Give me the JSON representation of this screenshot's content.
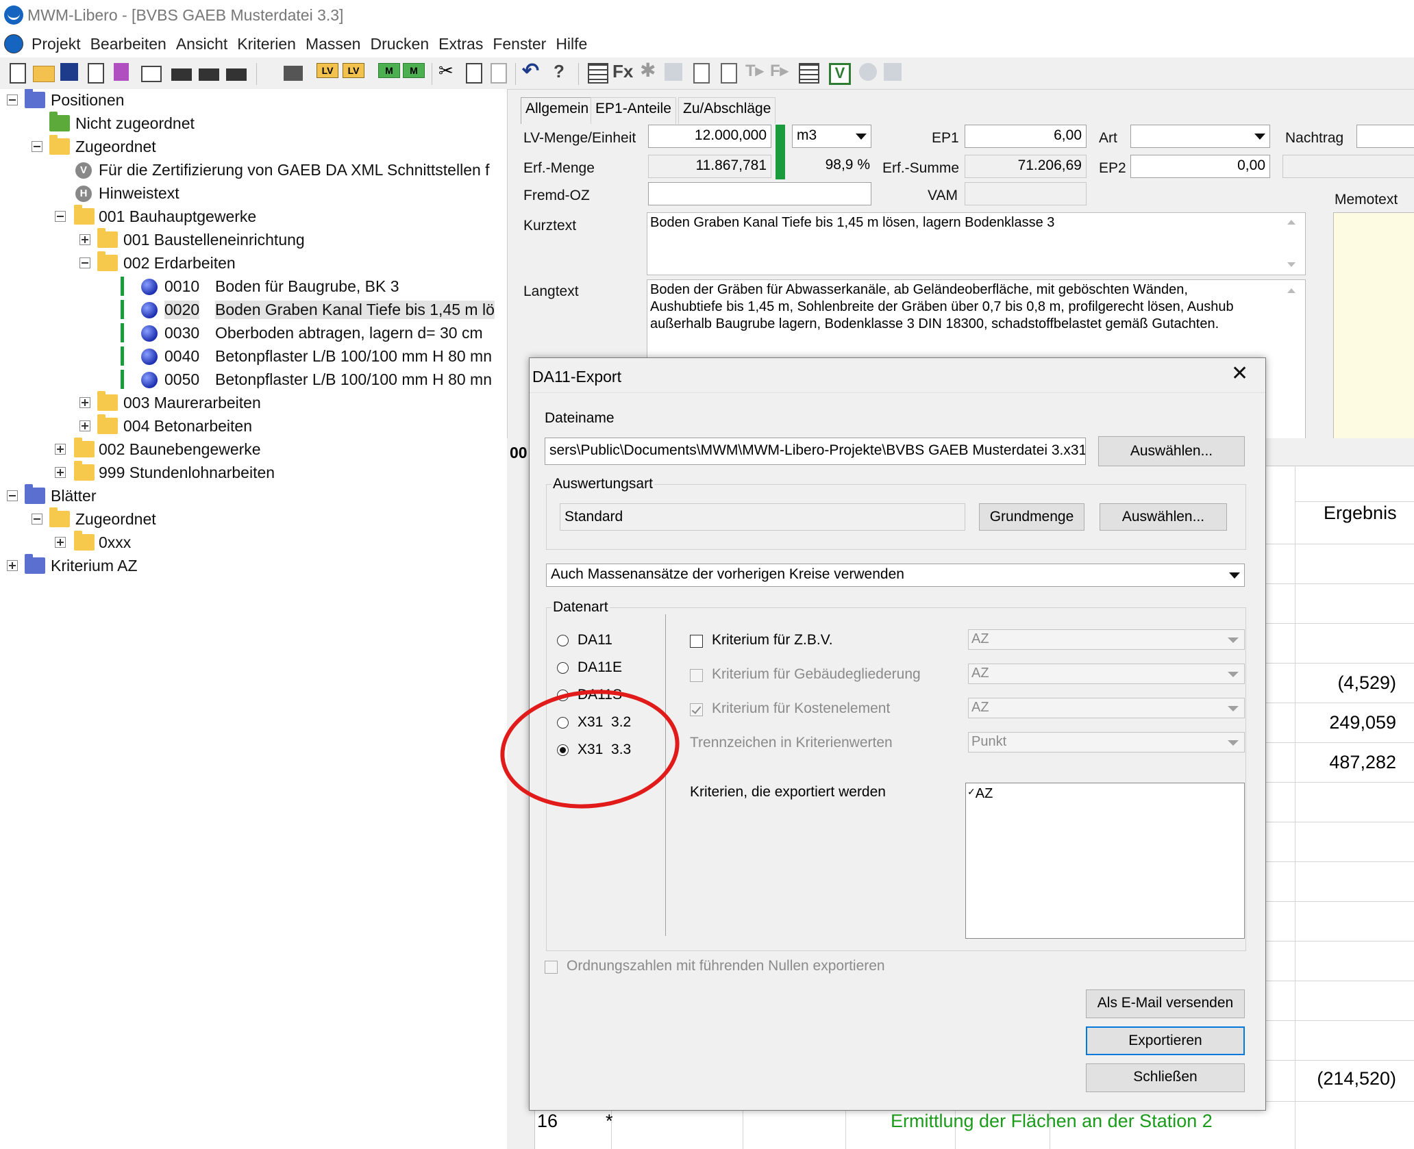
{
  "window": {
    "title": "MWM-Libero - [BVBS GAEB Musterdatei 3.3]"
  },
  "menu": [
    "Projekt",
    "Bearbeiten",
    "Ansicht",
    "Kriterien",
    "Massen",
    "Drucken",
    "Extras",
    "Fenster",
    "Hilfe"
  ],
  "toolbar": {
    "fx_label": "Fx",
    "lv1": "LV",
    "lv2": "LV",
    "m1": "M",
    "m2": "M",
    "help": "?",
    "v": "V"
  },
  "tree": [
    {
      "label": "Positionen"
    },
    {
      "label": "Nicht zugeordnet"
    },
    {
      "label": "Zugeordnet"
    },
    {
      "label": "Für die Zertifizierung von GAEB DA XML Schnittstellen f",
      "glyph": "V"
    },
    {
      "label": "Hinweistext",
      "glyph": "H"
    },
    {
      "label": "001 Bauhauptgewerke"
    },
    {
      "label": "001 Baustelleneinrichtung"
    },
    {
      "label": "002 Erdarbeiten"
    },
    {
      "oz": "0010",
      "label": "Boden für Baugrube, BK 3"
    },
    {
      "oz": "0020",
      "label": "Boden Graben Kanal Tiefe bis 1,45 m lö"
    },
    {
      "oz": "0030",
      "label": "Oberboden abtragen, lagern d= 30 cm"
    },
    {
      "oz": "0040",
      "label": "Betonpflaster L/B 100/100 mm H 80 mn"
    },
    {
      "oz": "0050",
      "label": "Betonpflaster L/B 100/100 mm H 80 mn"
    },
    {
      "label": "003 Maurerarbeiten"
    },
    {
      "label": "004 Betonarbeiten"
    },
    {
      "label": "002 Baunebengewerke"
    },
    {
      "label": "999 Stundenlohnarbeiten"
    },
    {
      "label": "Blätter"
    },
    {
      "label": "Zugeordnet"
    },
    {
      "label": "0xxx"
    },
    {
      "label": "Kriterium AZ"
    }
  ],
  "tabs": [
    "Allgemein",
    "EP1-Anteile",
    "Zu/Abschläge"
  ],
  "form": {
    "lv_menge_label": "LV-Menge/Einheit",
    "lv_menge": "12.000,000",
    "einheit": "m3",
    "ep1_label": "EP1",
    "ep1": "6,00",
    "art_label": "Art",
    "art": "",
    "nachtrag_label": "Nachtrag",
    "erf_menge_label": "Erf.-Menge",
    "erf_menge": "11.867,781",
    "percent": "98,9 %",
    "erf_summe_label": "Erf.-Summe",
    "erf_summe": "71.206,69",
    "ep2_label": "EP2",
    "ep2": "0,00",
    "fremd_oz_label": "Fremd-OZ",
    "fremd_oz": "",
    "vam_label": "VAM",
    "memotext_label": "Memotext",
    "kurztext_label": "Kurztext",
    "kurztext": "Boden Graben Kanal Tiefe bis 1,45 m lösen, lagern Bodenklasse 3",
    "langtext_label": "Langtext",
    "langtext": [
      "Boden der Gräben für Abwasserkanäle, ab Geländeoberfläche, mit geböschten Wänden,",
      "Aushubtiefe bis 1,45 m, Sohlenbreite der Gräben über 0,7 bis 0,8 m, profilgerecht lösen, Aushub",
      "außerhalb Baugrube lagern, Bodenklasse 3 DIN 18300, schadstoffbelastet gemäß Gutachten."
    ]
  },
  "grid": {
    "col_header_left": "00",
    "ergebnis_label": "Ergebnis",
    "values": [
      "(4,529)",
      "249,059",
      "487,282",
      "(214,520)"
    ],
    "row_num": "16",
    "row_star": "*",
    "row_text": "Ermittlung der Flächen an der Station 2"
  },
  "dialog": {
    "title": "DA11-Export",
    "close": "✕",
    "dateiname_label": "Dateiname",
    "dateiname": "sers\\Public\\Documents\\MWM\\MWM-Libero-Projekte\\BVBS GAEB Musterdatei 3.x31",
    "auswaehlen1": "Auswählen...",
    "auswertungsart_label": "Auswertungsart",
    "auswertungsart": "Standard",
    "grundmenge": "Grundmenge",
    "auswaehlen2": "Auswählen...",
    "massenansaetze": "Auch Massenansätze der vorherigen Kreise verwenden",
    "datenart_label": "Datenart",
    "datenart": [
      {
        "label": "DA11",
        "selected": false
      },
      {
        "label": "DA11E",
        "selected": false
      },
      {
        "label": "DA11S",
        "selected": false
      },
      {
        "label": "X31  3.2",
        "selected": false
      },
      {
        "label": "X31  3.3",
        "selected": true
      }
    ],
    "krit_zbv": "Kriterium für Z.B.V.",
    "krit_zbv_value": "AZ",
    "krit_gebaeude": "Kriterium für Gebäudegliederung",
    "krit_gebaeude_value": "AZ",
    "krit_kosten": "Kriterium für Kostenelement",
    "krit_kosten_value": "AZ",
    "trennzeichen": "Trennzeichen in Kriterienwerten",
    "trennzeichen_value": "Punkt",
    "kriterien_export_label": "Kriterien, die exportiert werden",
    "kriterien_list": [
      "AZ"
    ],
    "ordnungszahlen": "Ordnungszahlen mit führenden Nullen exportieren",
    "email_btn": "Als E-Mail versenden",
    "export_btn": "Exportieren",
    "close_btn": "Schließen"
  },
  "colors": {
    "accent": "#0078d7",
    "annotation": "#e11a1a",
    "green_text": "#1a9c1a"
  }
}
